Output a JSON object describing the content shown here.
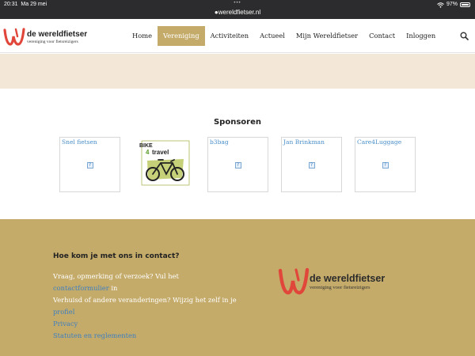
{
  "status_bar": {
    "time": "20:31",
    "date": "Ma 29 mei",
    "url": "wereldfietser.nl",
    "battery": "97%",
    "battery_fraction": 0.97
  },
  "brand": {
    "title": "de wereldfietser",
    "subtitle": "vereniging voor fietsreizigers",
    "accent_color": "#c4ab6a",
    "logo_red": "#e0473a"
  },
  "nav": {
    "items": [
      "Home",
      "Vereniging",
      "Activiteiten",
      "Actueel",
      "Mijn Wereldfietser",
      "Contact",
      "Inloggen"
    ],
    "active": "Vereniging"
  },
  "sponsors": {
    "title": "Sponsoren",
    "items": [
      {
        "name": "Snel fietsen"
      },
      {
        "name": "BIKE 4 travel",
        "logo_top": "BIKE",
        "logo_num": "4",
        "logo_word": "travel"
      },
      {
        "name": "b3bag"
      },
      {
        "name": "Jan Brinkman"
      },
      {
        "name": "Care4Luggage"
      }
    ]
  },
  "footer": {
    "heading": "Hoe kom je met ons in contact?",
    "line1": "Vraag, opmerking of verzoek? Vul het",
    "link1": "contactformulier",
    "line1_suffix": " in",
    "line2": "Verhuisd of andere veranderingen? Wijzig het zelf in je",
    "link2": "profiel",
    "link3": "Privacy",
    "link4": "Statuten en reglementen"
  }
}
